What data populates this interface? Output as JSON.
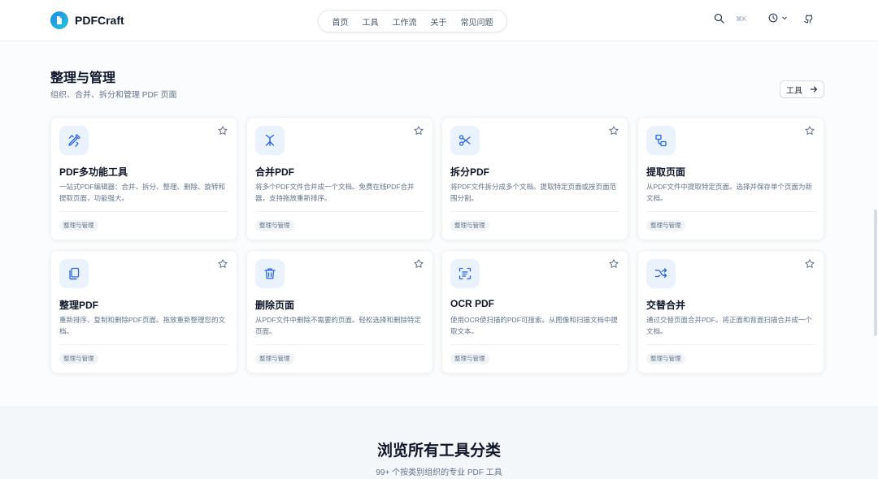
{
  "header": {
    "brand": "PDFCraft",
    "nav": [
      "首页",
      "工具",
      "工作流",
      "关于",
      "常见问题"
    ],
    "shortcut": "⌘K"
  },
  "section": {
    "title": "整理与管理",
    "subtitle": "组织、合并、拆分和管理 PDF 页面",
    "tools_button": "工具"
  },
  "cards": [
    {
      "icon": "tool-edit-icon",
      "title": "PDF多功能工具",
      "desc": "一站式PDF编辑器：合并、拆分、整理、删除、旋转和提取页面，功能强大。",
      "tag": "整理与管理"
    },
    {
      "icon": "merge-icon",
      "title": "合并PDF",
      "desc": "将多个PDF文件合并成一个文档。免费在线PDF合并器，支持拖放重新排序。",
      "tag": "整理与管理"
    },
    {
      "icon": "scissors-icon",
      "title": "拆分PDF",
      "desc": "将PDF文件拆分成多个文档。提取特定页面或按页面范围分割。",
      "tag": "整理与管理"
    },
    {
      "icon": "extract-pages-icon",
      "title": "提取页面",
      "desc": "从PDF文件中提取特定页面。选择并保存单个页面为新文档。",
      "tag": "整理与管理"
    },
    {
      "icon": "copy-pages-icon",
      "title": "整理PDF",
      "desc": "重新排序、复制和删除PDF页面。拖放重新整理您的文档。",
      "tag": "整理与管理"
    },
    {
      "icon": "trash-icon",
      "title": "删除页面",
      "desc": "从PDF文件中删除不需要的页面。轻松选择和删除特定页面。",
      "tag": "整理与管理"
    },
    {
      "icon": "scan-text-icon",
      "title": "OCR PDF",
      "desc": "使用OCR使扫描的PDF可搜索。从图像和扫描文档中提取文本。",
      "tag": "整理与管理"
    },
    {
      "icon": "shuffle-icon",
      "title": "交替合并",
      "desc": "通过交替页面合并PDF。将正面和背面扫描合并成一个文档。",
      "tag": "整理与管理"
    }
  ],
  "browse": {
    "title": "浏览所有工具分类",
    "subtitle": "99+ 个按类别组织的专业 PDF 工具"
  },
  "colors": {
    "accent": "#2563eb",
    "icon_bg": "#eaf2fd"
  }
}
